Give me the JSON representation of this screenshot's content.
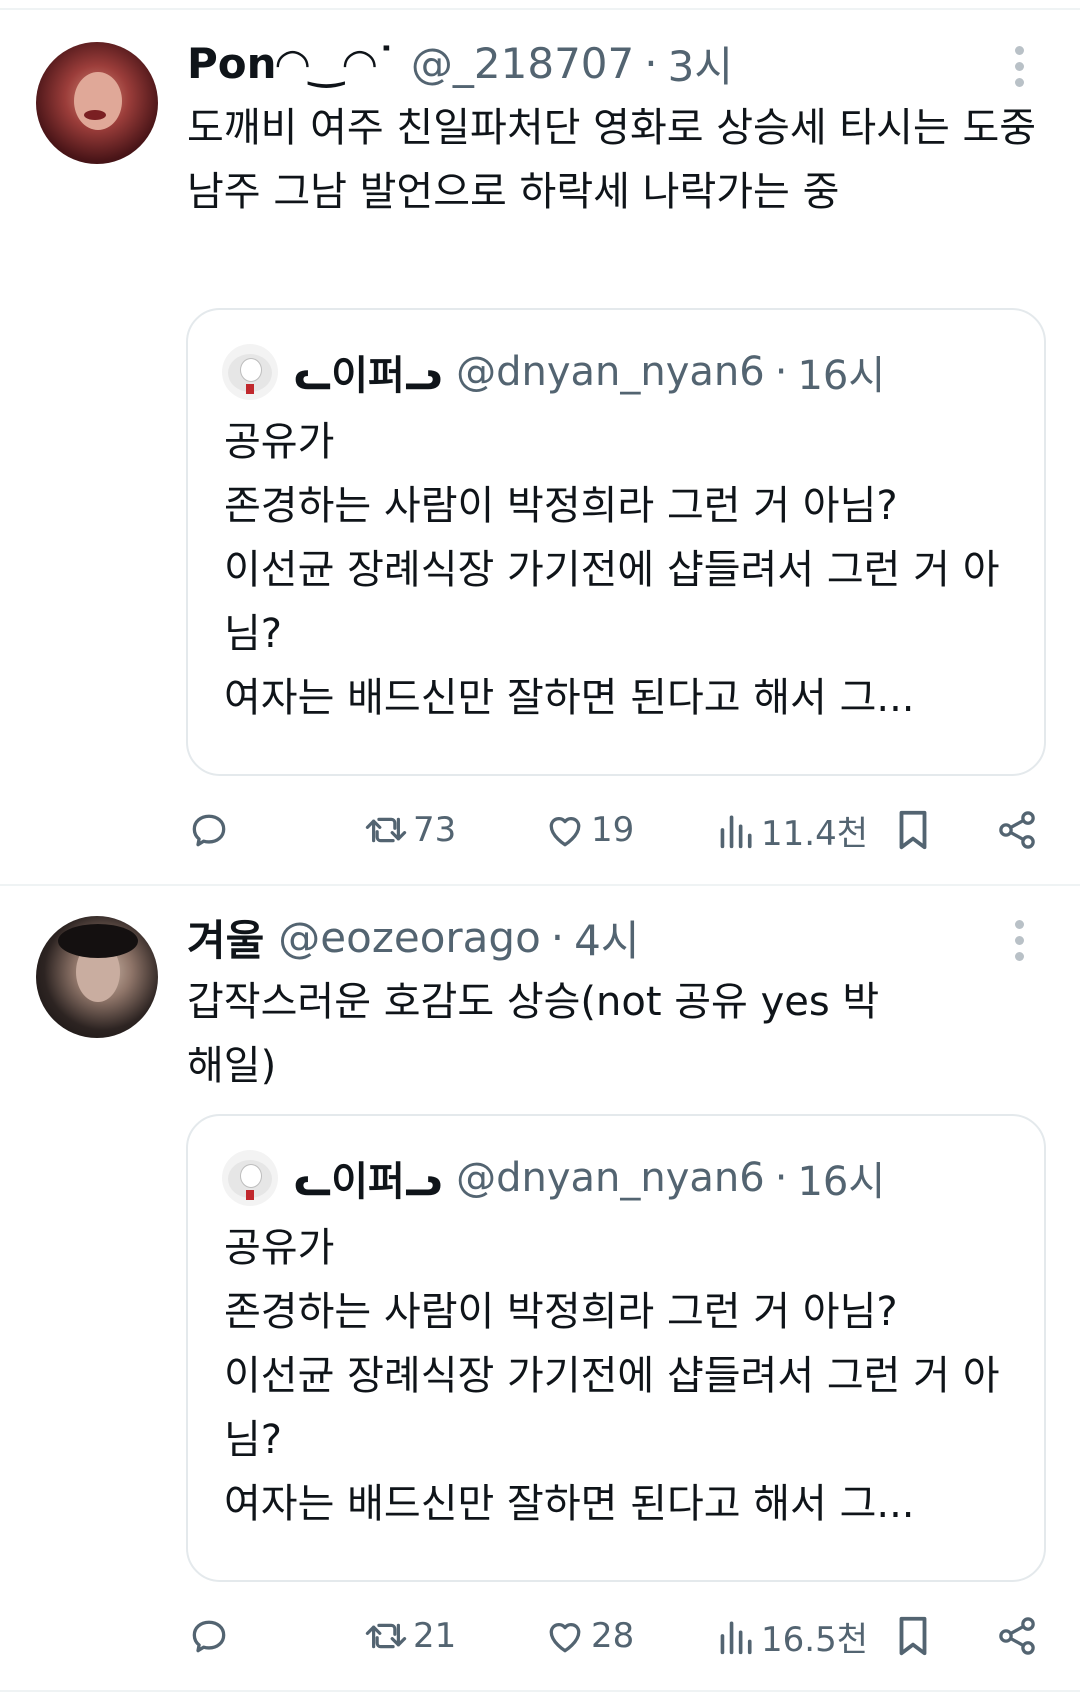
{
  "tweets": [
    {
      "name": "Pon◠‿◠˙",
      "handle": "@_218707",
      "separator": "·",
      "time": "3시",
      "text": "도깨비 여주 친일파처단 영화로 상승세 타시는 도중\n남주 그남 발언으로 하락세 나락가는 중",
      "quote": {
        "name": "ᓚ이퍼ᓗ",
        "handle": "@dnyan_nyan6",
        "separator": "·",
        "time": "16시",
        "text": "공유가\n존경하는 사람이 박정희라 그런 거 아님?\n이선균 장례식장 가기전에 샵들려서 그런 거 아님?\n여자는 배드신만 잘하면 된다고 해서 그..."
      },
      "stats": {
        "reply": "",
        "retweet": "73",
        "like": "19",
        "views": "11.4천"
      }
    },
    {
      "name": "겨울",
      "handle": "@eozeorago",
      "separator": "·",
      "time": "4시",
      "text": "갑작스러운 호감도 상승(not 공유 yes 박해일)",
      "quote": {
        "name": "ᓚ이퍼ᓗ",
        "handle": "@dnyan_nyan6",
        "separator": "·",
        "time": "16시",
        "text": "공유가\n존경하는 사람이 박정희라 그런 거 아님?\n이선균 장례식장 가기전에 샵들려서 그런 거 아님?\n여자는 배드신만 잘하면 된다고 해서 그..."
      },
      "stats": {
        "reply": "",
        "retweet": "21",
        "like": "28",
        "views": "16.5천"
      }
    }
  ],
  "colors": {
    "text": "#0f1419",
    "muted": "#536471",
    "border": "#e4e9ec",
    "divider": "#eff3f4"
  },
  "icons": [
    "reply-icon",
    "retweet-icon",
    "like-icon",
    "views-icon",
    "bookmark-icon",
    "share-icon",
    "more-icon"
  ]
}
